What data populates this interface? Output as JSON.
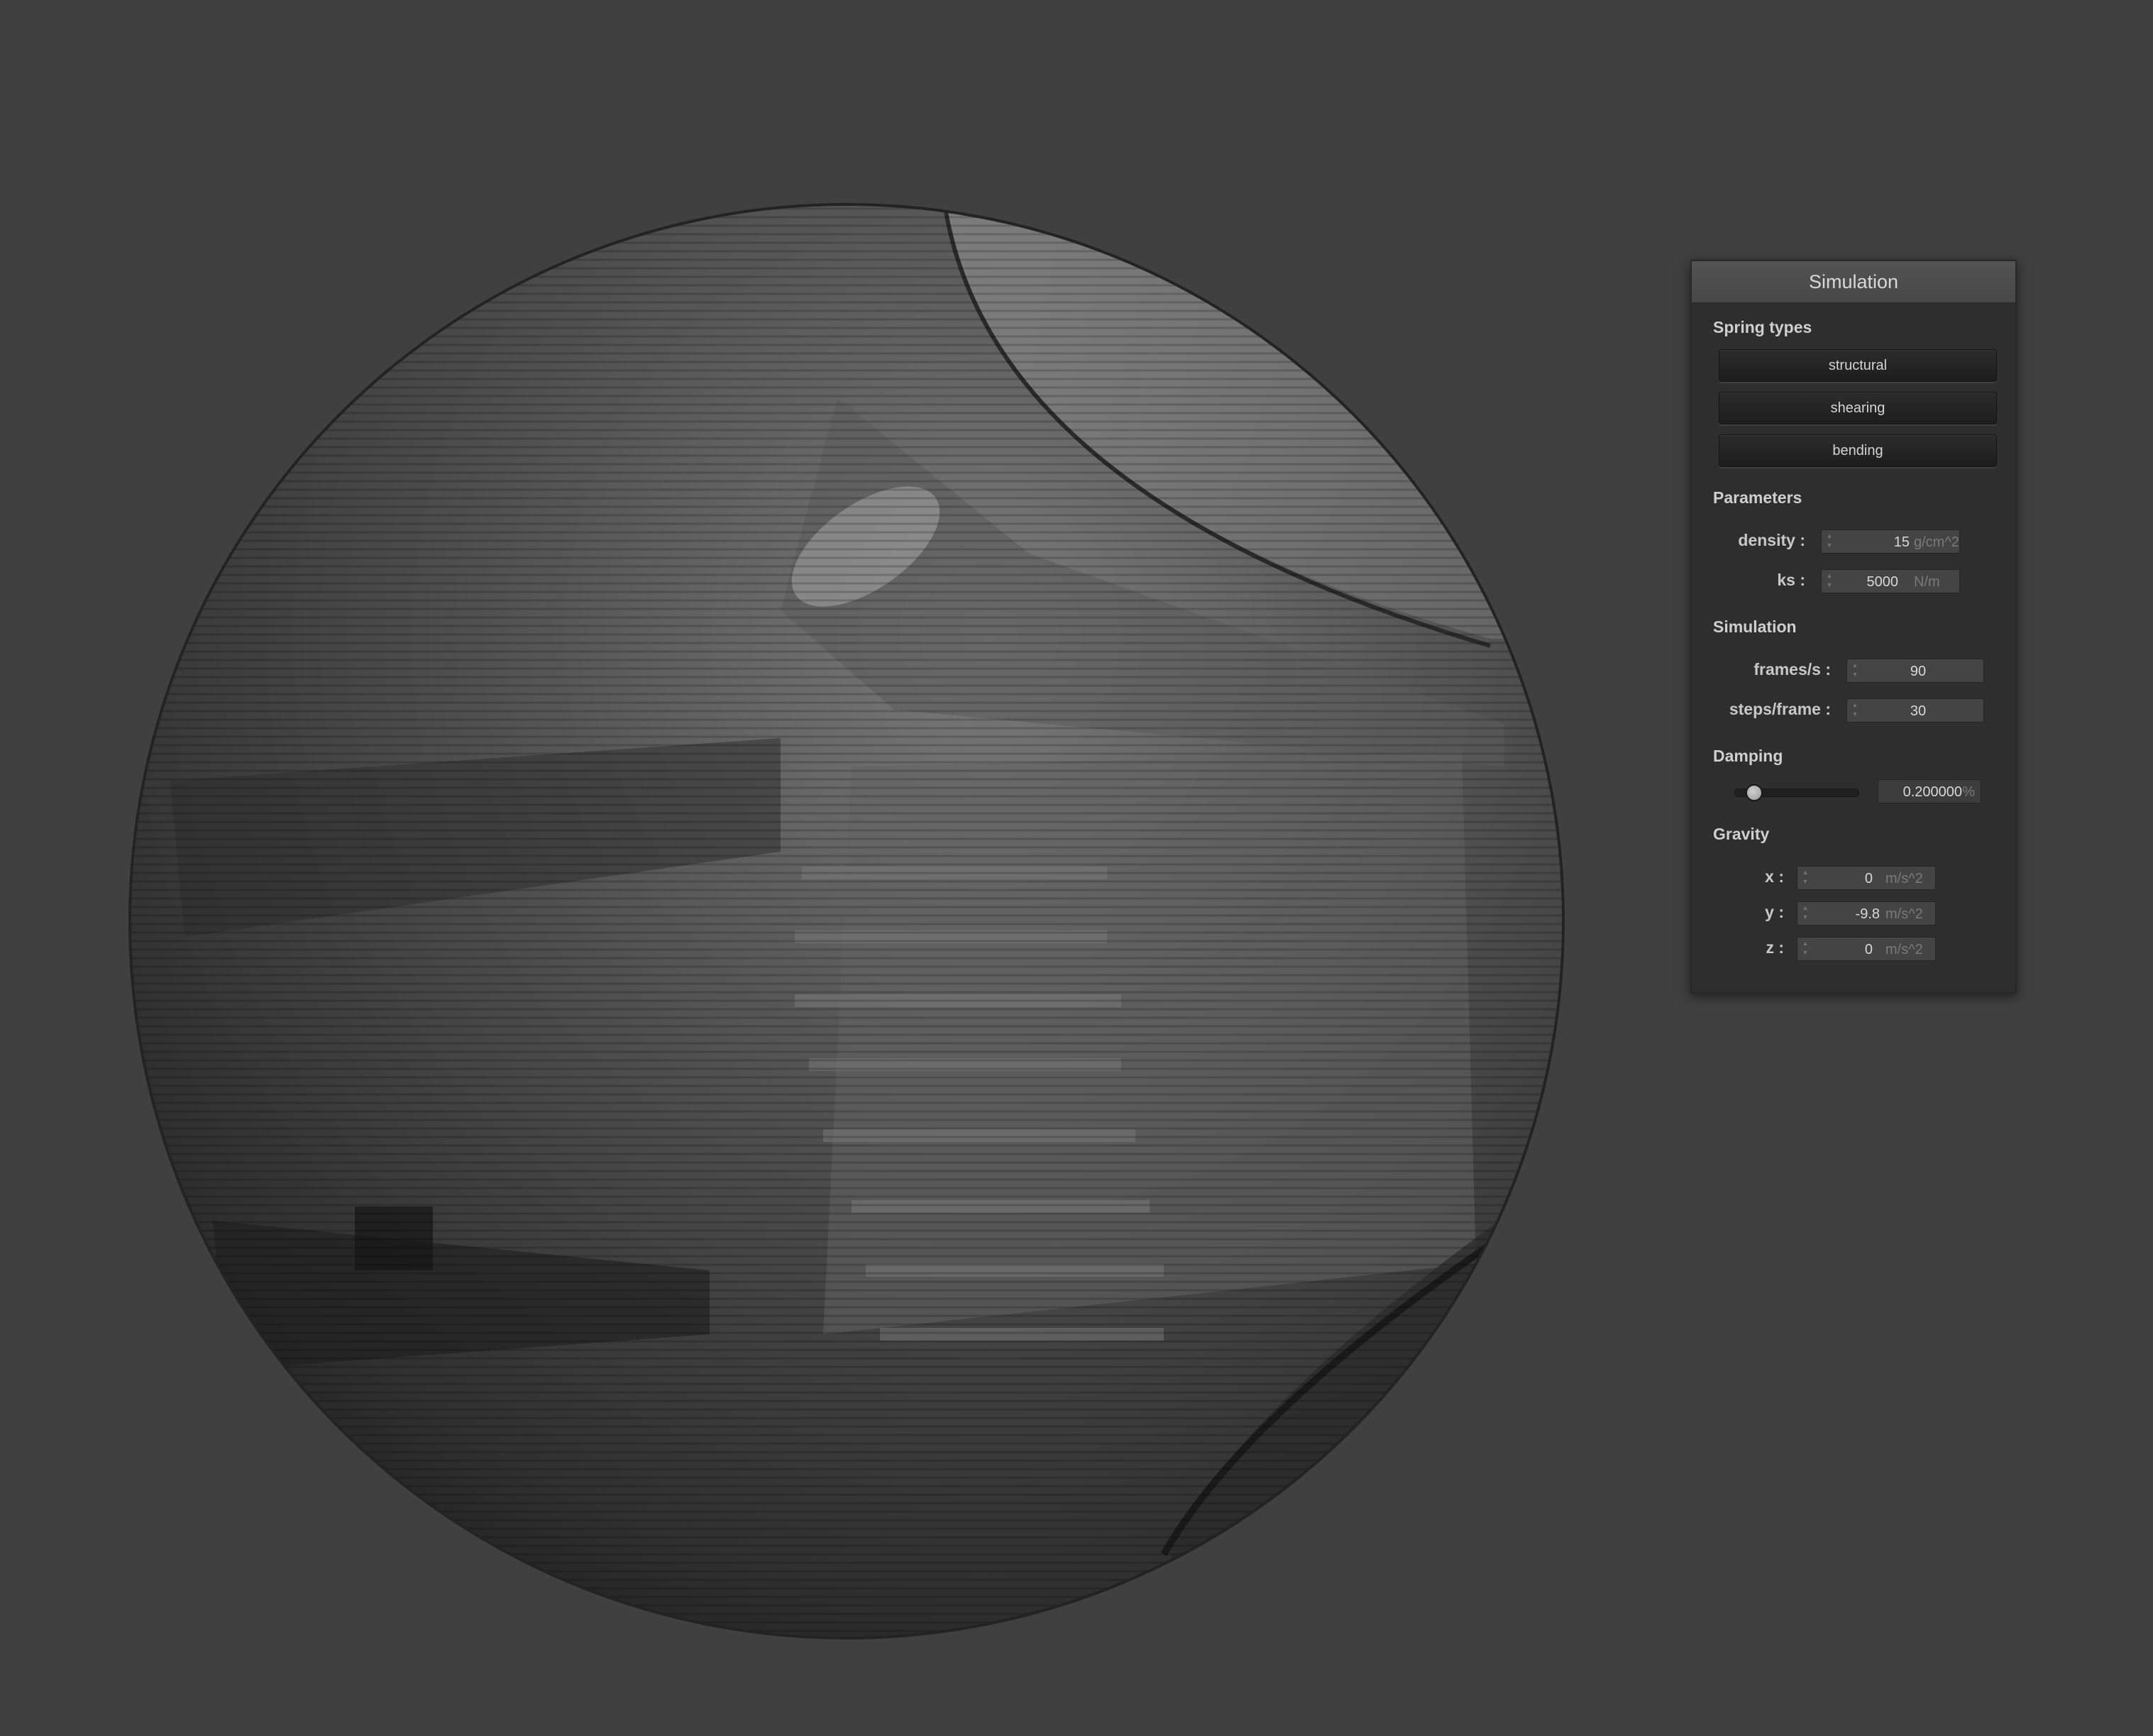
{
  "scene": {
    "object": "textured sphere"
  },
  "panel": {
    "title": "Simulation",
    "spring_types": {
      "heading": "Spring types",
      "buttons": [
        "structural",
        "shearing",
        "bending"
      ]
    },
    "parameters": {
      "heading": "Parameters",
      "density": {
        "label": "density :",
        "value": "15",
        "unit": "g/cm^2"
      },
      "ks": {
        "label": "ks :",
        "value": "5000",
        "unit": "N/m"
      }
    },
    "simulation": {
      "heading": "Simulation",
      "frames": {
        "label": "frames/s :",
        "value": "90"
      },
      "steps": {
        "label": "steps/frame :",
        "value": "30"
      }
    },
    "damping": {
      "heading": "Damping",
      "slider_fraction": 0.1,
      "value": "0.200000",
      "unit": "%"
    },
    "gravity": {
      "heading": "Gravity",
      "x": {
        "label": "x :",
        "value": "0",
        "unit": "m/s^2"
      },
      "y": {
        "label": "y :",
        "value": "-9.8",
        "unit": "m/s^2"
      },
      "z": {
        "label": "z :",
        "value": "0",
        "unit": "m/s^2"
      }
    }
  }
}
